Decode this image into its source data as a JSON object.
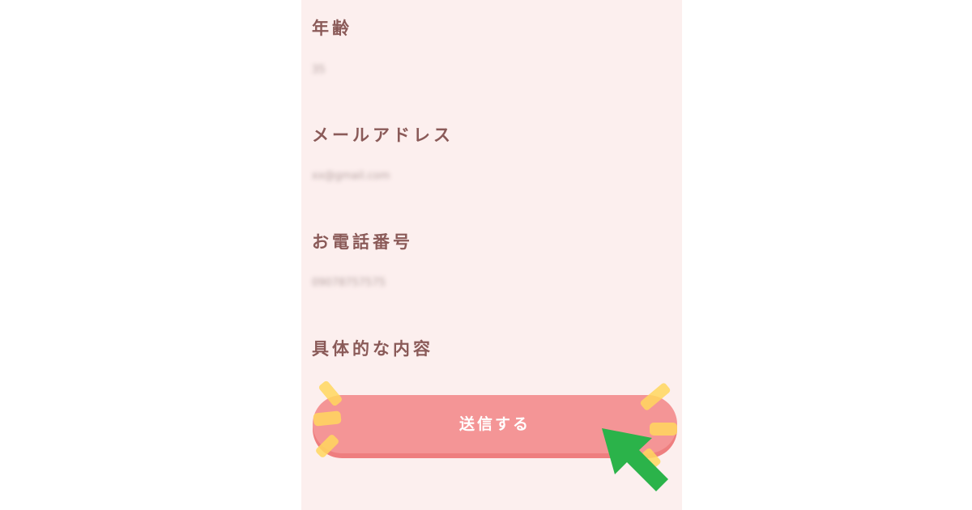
{
  "form": {
    "fields": [
      {
        "label": "年齢",
        "value": "35"
      },
      {
        "label": "メールアドレス",
        "value": "xx@gmail.com"
      },
      {
        "label": "お電話番号",
        "value": "09078757575"
      },
      {
        "label": "具体的な内容",
        "value": ""
      }
    ],
    "submit_label": "送信する"
  },
  "colors": {
    "panel_background": "#fcefee",
    "label_text": "#8a5a58",
    "button_fill": "#f49596",
    "button_shadow": "#ee7e7f",
    "sparkle": "#ffd75e",
    "arrow": "#2bb34a"
  },
  "icons": {
    "decoration": "sparkle-icon",
    "pointer": "arrow-pointer-icon"
  }
}
